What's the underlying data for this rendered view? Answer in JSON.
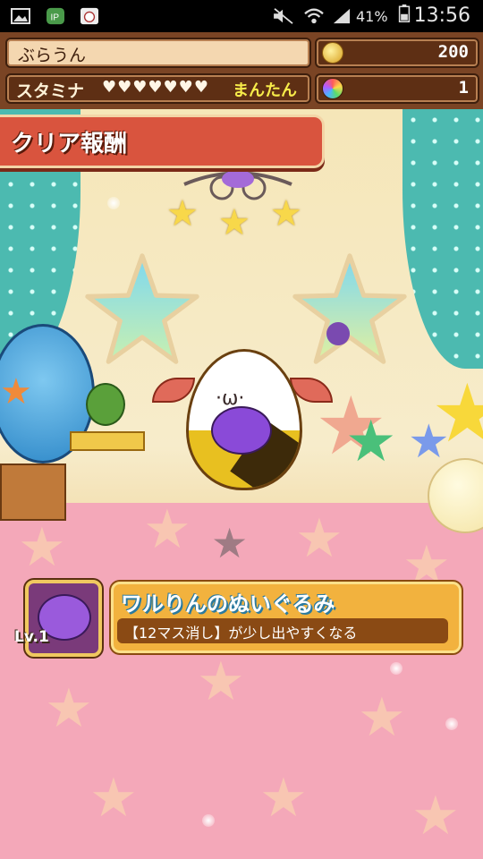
{
  "status_bar": {
    "icons": [
      "image-icon",
      "line-app-icon",
      "cat-app-icon",
      "mute-icon",
      "wifi-icon",
      "signal-icon",
      "battery-icon"
    ],
    "battery_percent": "41%",
    "time": "13:56"
  },
  "hud": {
    "player_name": "ぶらうん",
    "stamina_label": "スタミナ",
    "stamina_hearts": "♥♥♥♥♥♥♥",
    "stamina_status": "まんたん",
    "coins": "200",
    "gems": "1",
    "coin_icon": "coin-icon",
    "gem_icon": "rainbow-gem-icon"
  },
  "banner": {
    "title": "クリア報酬"
  },
  "reward": {
    "item_name": "ワルりんのぬいぐるみ",
    "item_description": "【12マス消し】が少し出やすくなる",
    "item_level": "Lv.1",
    "item_icon": "purple-bat-plush-icon"
  },
  "colors": {
    "hud_brown": "#7a4424",
    "banner_red": "#d9543e",
    "card_orange": "#f2b23e",
    "floor_pink": "#f4a8b9",
    "curtain_teal": "#4cbab0"
  }
}
